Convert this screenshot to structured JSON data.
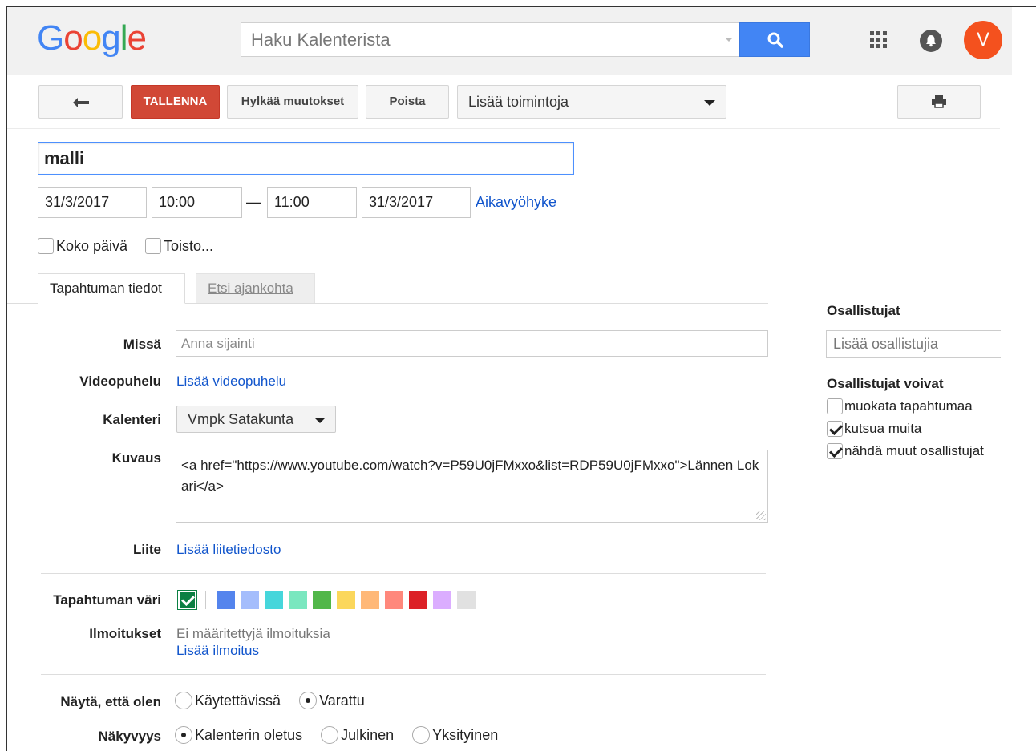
{
  "header": {
    "search_placeholder": "Haku Kalenterista",
    "avatar_letter": "V"
  },
  "toolbar": {
    "save_label": "TALLENNA",
    "discard_label": "Hylkää muutokset",
    "delete_label": "Poista",
    "more_actions_label": "Lisää toimintoja"
  },
  "event": {
    "title": "malli",
    "start_date": "31/3/2017",
    "start_time": "10:00",
    "dash": "—",
    "end_time": "11:00",
    "end_date": "31/3/2017",
    "timezone_link": "Aikavyöhyke",
    "all_day_label": "Koko päivä",
    "repeat_label": "Toisto..."
  },
  "tabs": {
    "details": "Tapahtuman tiedot",
    "find_time": "Etsi ajankohta"
  },
  "details": {
    "where_label": "Missä",
    "where_placeholder": "Anna sijainti",
    "video_label": "Videopuhelu",
    "video_link": "Lisää videopuhelu",
    "calendar_label": "Kalenteri",
    "calendar_value": "Vmpk Satakunta",
    "description_label": "Kuvaus",
    "description_value": "<a href=\"https://www.youtube.com/watch?v=P59U0jFMxxo&list=RDP59U0jFMxxo\">Lännen Lokari</a>",
    "attachment_label": "Liite",
    "attachment_link": "Lisää liitetiedosto",
    "color_label": "Tapahtuman väri",
    "colors": [
      "#5484ed",
      "#a4bdfc",
      "#46d6db",
      "#7ae7bf",
      "#51b749",
      "#fbd75b",
      "#ffb878",
      "#ff887c",
      "#dc2127",
      "#dbadff",
      "#e1e1e1"
    ],
    "notifications_label": "Ilmoitukset",
    "notifications_none": "Ei määritettyjä ilmoituksia",
    "notifications_add": "Lisää ilmoitus",
    "show_as_label": "Näytä, että olen",
    "show_as_available": "Käytettävissä",
    "show_as_busy": "Varattu",
    "visibility_label": "Näkyvyys",
    "visibility_default": "Kalenterin oletus",
    "visibility_public": "Julkinen",
    "visibility_private": "Yksityinen"
  },
  "guests": {
    "heading": "Osallistujat",
    "add_placeholder": "Lisää osallistujia",
    "permissions_heading": "Osallistujat voivat",
    "perm_modify": "muokata tapahtumaa",
    "perm_invite": "kutsua muita",
    "perm_see_list": "nähdä muut osallistujat"
  }
}
